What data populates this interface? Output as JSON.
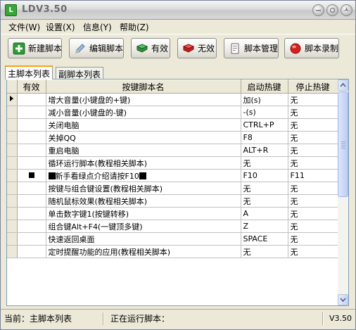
{
  "window": {
    "title": "LDV3.50",
    "app_icon_glyph": "L"
  },
  "menu": [
    {
      "label": "文件(W)"
    },
    {
      "label": "设置(X)"
    },
    {
      "label": "信息(Y)"
    },
    {
      "label": "帮助(Z)"
    }
  ],
  "toolbar": {
    "new_label": "新建脚本",
    "edit_label": "编辑脚本",
    "enable_label": "有效",
    "disable_label": "无效",
    "manage_label": "脚本管理",
    "record_label": "脚本录制"
  },
  "tabs": [
    {
      "label": "主脚本列表",
      "active": true
    },
    {
      "label": "副脚本列表",
      "active": false
    }
  ],
  "table": {
    "columns": [
      "有效",
      "按键脚本名",
      "启动热键",
      "停止热键"
    ],
    "rows": [
      {
        "name": "增大音量(小键盘的+键)",
        "start": "加(s)",
        "stop": "无",
        "enabled": false,
        "current": true
      },
      {
        "name": "减小音量(小键盘的-键)",
        "start": "-(s)",
        "stop": "无",
        "enabled": false
      },
      {
        "name": "关闭电脑",
        "start": "CTRL+P",
        "stop": "无",
        "enabled": false
      },
      {
        "name": "关掉QQ",
        "start": "F8",
        "stop": "无",
        "enabled": false
      },
      {
        "name": "重启电脑",
        "start": "ALT+R",
        "stop": "无",
        "enabled": false
      },
      {
        "name": "循环运行脚本(教程相关脚本)",
        "start": "无",
        "stop": "无",
        "enabled": false
      },
      {
        "name": "新手看绿点介绍请按F10",
        "start": "F10",
        "stop": "F11",
        "enabled": true,
        "marked": true
      },
      {
        "name": "按键与组合键设置(教程相关脚本)",
        "start": "无",
        "stop": "无",
        "enabled": false
      },
      {
        "name": "随机鼠标效果(教程相关脚本)",
        "start": "无",
        "stop": "无",
        "enabled": false
      },
      {
        "name": "单击数字键1(按键转移)",
        "start": "A",
        "stop": "无",
        "enabled": false
      },
      {
        "name": "组合键Alt+F4(一键顶多键)",
        "start": "Z",
        "stop": "无",
        "enabled": false
      },
      {
        "name": "快速返回桌面",
        "start": "SPACE",
        "stop": "无",
        "enabled": false
      },
      {
        "name": "定时提醒功能的应用(教程相关脚本)",
        "start": "无",
        "stop": "无",
        "enabled": false
      }
    ]
  },
  "status": {
    "current": "当前：主脚本列表",
    "running": "正在运行脚本：",
    "version": "V3.50"
  }
}
